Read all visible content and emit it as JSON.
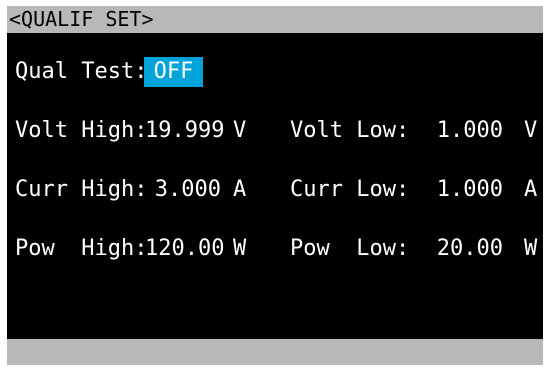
{
  "title": "<QUALIF SET>",
  "qual_test": {
    "label": "Qual Test:",
    "value": "OFF",
    "highlight_color": "#00a4d8"
  },
  "rows": [
    {
      "high_label": "Volt High:",
      "high_value": "19.999",
      "high_unit": "V",
      "low_label": "Volt Low:",
      "low_value": "1.000",
      "low_unit": "V"
    },
    {
      "high_label": "Curr High:",
      "high_value": "3.000",
      "high_unit": "A",
      "low_label": "Curr Low:",
      "low_value": "1.000",
      "low_unit": "A"
    },
    {
      "high_label": "Pow  High:",
      "high_value": "120.00",
      "high_unit": "W",
      "low_label": "Pow  Low:",
      "low_value": "20.00",
      "low_unit": "W"
    }
  ],
  "colors": {
    "screen_background": "#000000",
    "bar_background": "#b8b8b8",
    "text": "#ffffff"
  }
}
